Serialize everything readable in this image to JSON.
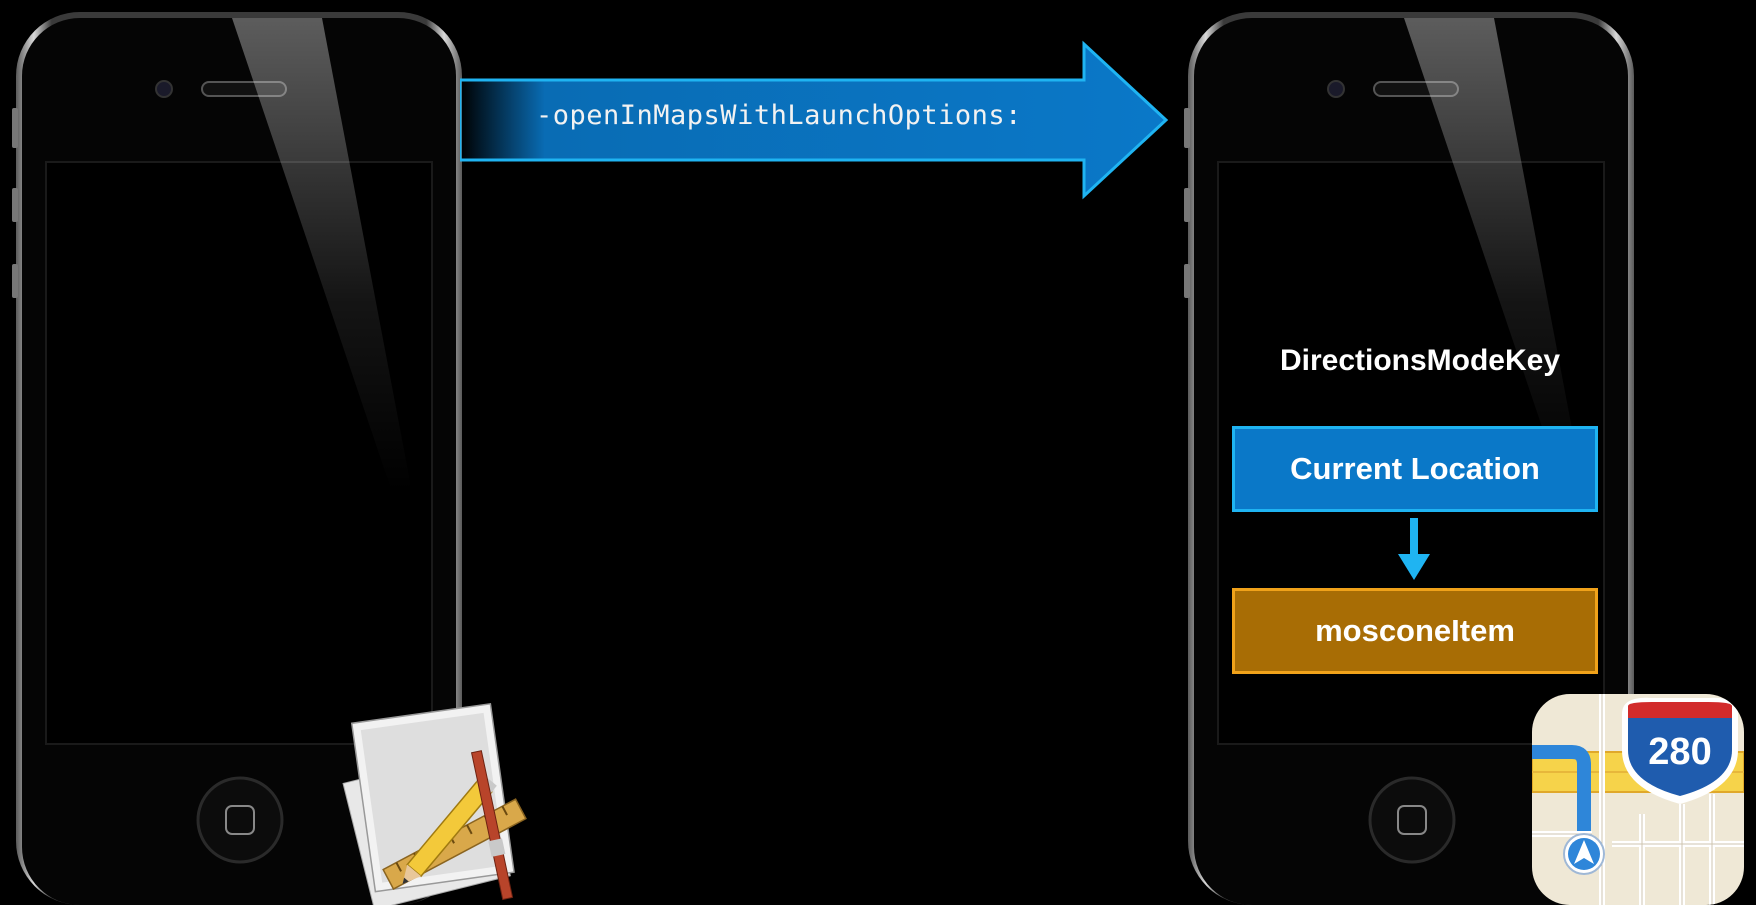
{
  "method_call": "-openInMapsWithLaunchOptions:",
  "directions_key": "DirectionsModeKey",
  "source_box": "Current Location",
  "target_box": "mosconeItem",
  "maps_icon": {
    "shield_number": "280"
  },
  "colors": {
    "arrow_blue": "#0a78c8",
    "arrow_border": "#1fb4f2",
    "current_location_fill": "#0a78c8",
    "moscone_fill": "#a86d05",
    "moscone_border": "#f0a21a"
  },
  "icons": [
    "xcode-app-icon",
    "maps-app-icon",
    "home-button-icon"
  ]
}
